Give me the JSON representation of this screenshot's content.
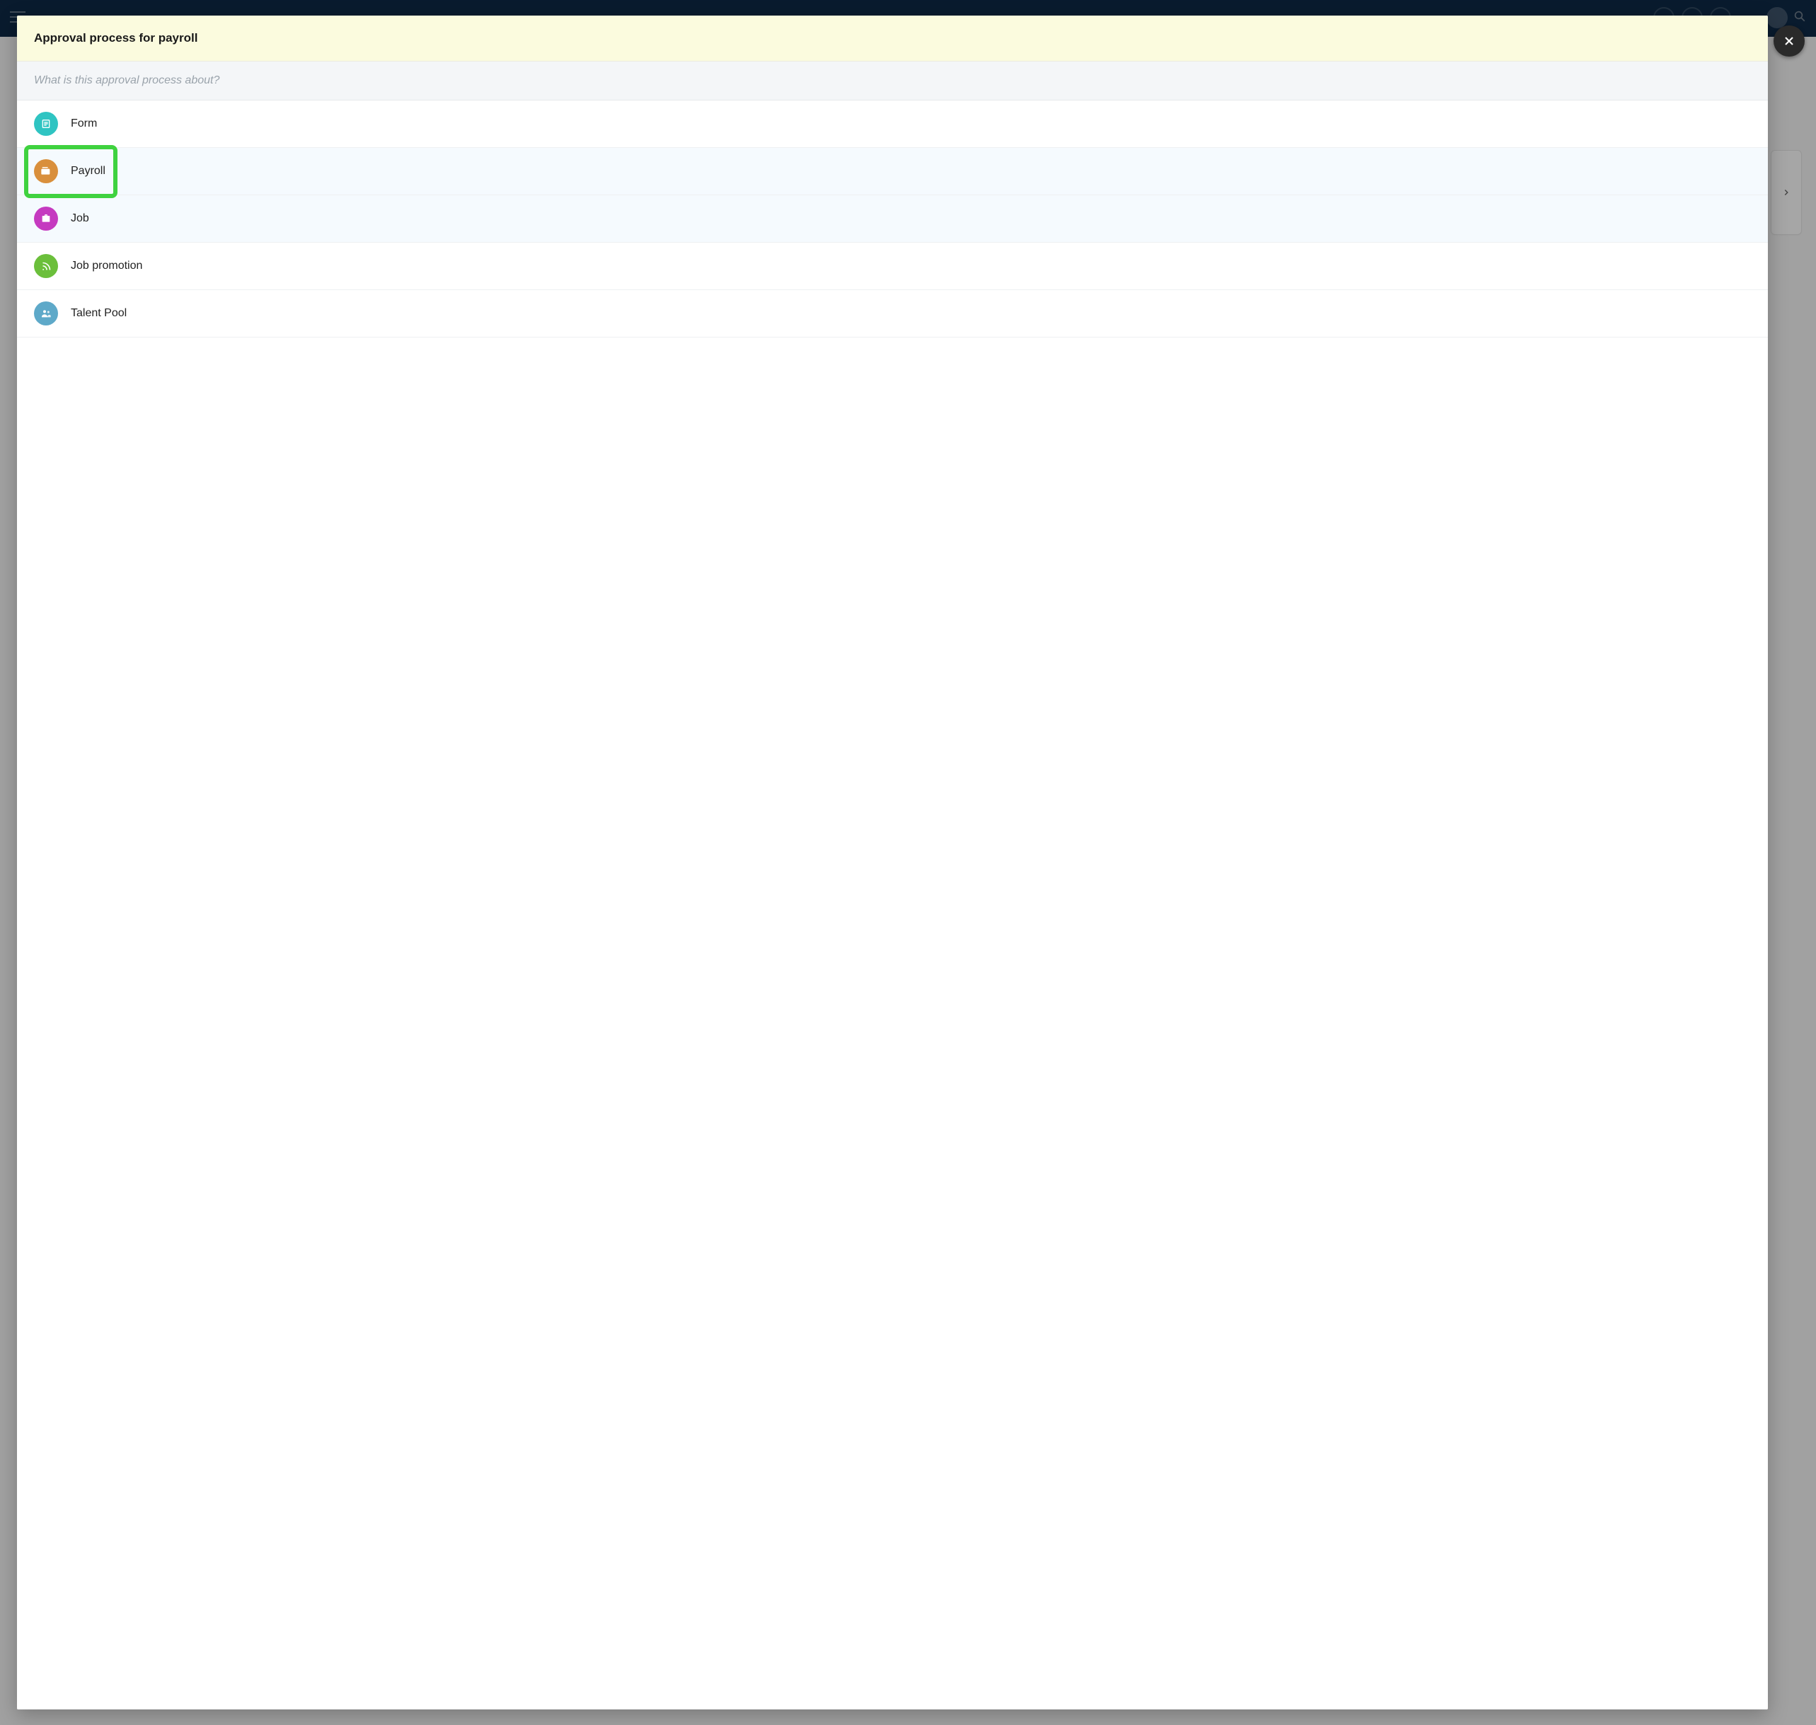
{
  "modal": {
    "title": "Approval process for payroll",
    "question": "What is this approval process about?",
    "options": [
      {
        "key": "form",
        "label": "Form",
        "icon": "list-icon",
        "color": "c-form"
      },
      {
        "key": "payroll",
        "label": "Payroll",
        "icon": "wallet-icon",
        "color": "c-payroll"
      },
      {
        "key": "job",
        "label": "Job",
        "icon": "briefcase-icon",
        "color": "c-job"
      },
      {
        "key": "job_promotion",
        "label": "Job promotion",
        "icon": "rss-icon",
        "color": "c-jobpromo"
      },
      {
        "key": "talent_pool",
        "label": "Talent Pool",
        "icon": "people-icon",
        "color": "c-talent"
      }
    ]
  },
  "highlight": {
    "target_key": "payroll",
    "color": "#3fd23f"
  }
}
